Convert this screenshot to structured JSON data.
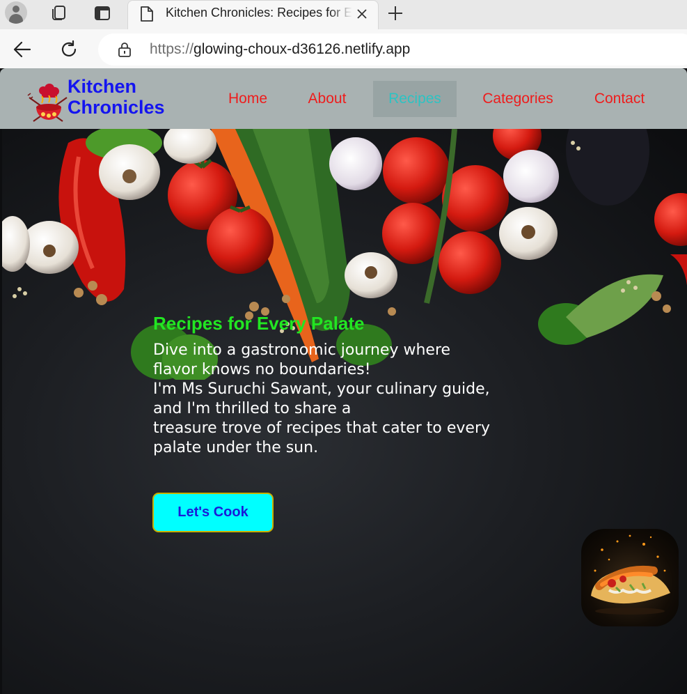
{
  "browser": {
    "tab": {
      "title": "Kitchen Chronicles: Recipes for Every Palate"
    },
    "address": {
      "scheme": "https://",
      "host": "glowing-choux-d36126.netlify.app"
    }
  },
  "site": {
    "logo": {
      "line1": "Kitchen",
      "line2": "Chronicles"
    },
    "nav": [
      {
        "label": "Home",
        "active": false
      },
      {
        "label": "About",
        "active": false
      },
      {
        "label": "Recipes",
        "active": true
      },
      {
        "label": "Categories",
        "active": false
      },
      {
        "label": "Contact",
        "active": false
      }
    ]
  },
  "hero": {
    "title": "Recipes for Every Palate",
    "lines": [
      "Dive into a gastronomic journey where",
      "flavor knows no boundaries!",
      "I'm Ms Suruchi Sawant, your culinary guide,",
      "and I'm thrilled to share a",
      "treasure trove of recipes that cater to every",
      "palate under the sun."
    ],
    "cta_label": "Let's Cook"
  },
  "colors": {
    "nav_link": "#ee1c1c",
    "nav_active": "#2cc3c3",
    "logo": "#1414f0",
    "hero_title": "#22e622",
    "cta_bg": "#00ffff"
  }
}
